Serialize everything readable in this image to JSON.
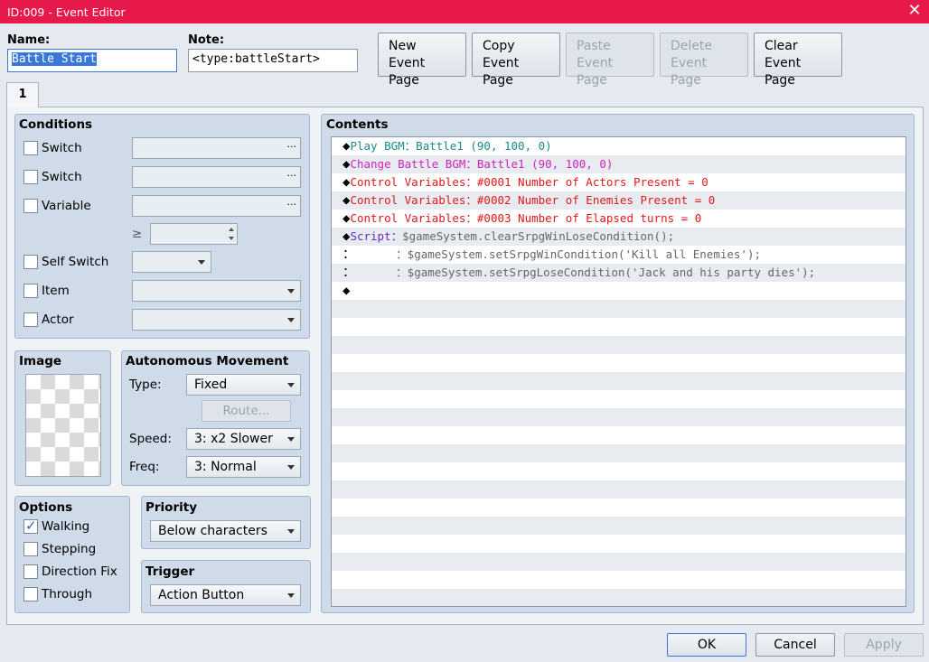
{
  "window": {
    "title": "ID:009 - Event Editor",
    "close_glyph": "✕"
  },
  "header": {
    "name_label": "Name:",
    "name_value": "Battle Start",
    "note_label": "Note:",
    "note_value": "<type:battleStart>"
  },
  "toolbar": {
    "new_l1": "New",
    "new_l2": "Event Page",
    "copy_l1": "Copy",
    "copy_l2": "Event Page",
    "paste_l1": "Paste",
    "paste_l2": "Event Page",
    "delete_l1": "Delete",
    "delete_l2": "Event Page",
    "clear_l1": "Clear",
    "clear_l2": "Event Page"
  },
  "tabs": [
    {
      "label": "1"
    }
  ],
  "conditions": {
    "title": "Conditions",
    "switch1": "Switch",
    "switch2": "Switch",
    "variable": "Variable",
    "gte": "≥",
    "self_switch": "Self Switch",
    "item": "Item",
    "actor": "Actor",
    "dots": "···"
  },
  "image": {
    "title": "Image"
  },
  "movement": {
    "title": "Autonomous Movement",
    "type_label": "Type:",
    "type_value": "Fixed",
    "route_label": "Route...",
    "speed_label": "Speed:",
    "speed_value": "3: x2 Slower",
    "freq_label": "Freq:",
    "freq_value": "3: Normal"
  },
  "options": {
    "title": "Options",
    "walking": "Walking",
    "walking_checked": true,
    "stepping": "Stepping",
    "direction_fix": "Direction Fix",
    "through": "Through"
  },
  "priority": {
    "title": "Priority",
    "value": "Below characters"
  },
  "trigger": {
    "title": "Trigger",
    "value": "Action Button"
  },
  "contents": {
    "title": "Contents",
    "lines": [
      {
        "prefix": "◆",
        "cmd": "Play BGM",
        "sep": "：",
        "arg": "Battle1 (90, 100, 0)",
        "color": "teal"
      },
      {
        "prefix": "◆",
        "cmd": "Change Battle BGM",
        "sep": "：",
        "arg": "Battle1 (90, 100, 0)",
        "color": "mag"
      },
      {
        "prefix": "◆",
        "cmd": "Control Variables",
        "sep": "：",
        "arg": "#0001 Number of Actors Present = 0",
        "color": "red"
      },
      {
        "prefix": "◆",
        "cmd": "Control Variables",
        "sep": "：",
        "arg": "#0002 Number of Enemies Present = 0",
        "color": "red"
      },
      {
        "prefix": "◆",
        "cmd": "Control Variables",
        "sep": "：",
        "arg": "#0003 Number of Elapsed turns = 0",
        "color": "red"
      },
      {
        "prefix": "◆",
        "cmd": "Script",
        "sep": "：",
        "arg": "$gameSystem.clearSrpgWinLoseCondition();",
        "color": "purple"
      },
      {
        "prefix": "：",
        "cmd": "      ",
        "sep": "：",
        "arg": "$gameSystem.setSrpgWinCondition('Kill all Enemies');",
        "color": "gray"
      },
      {
        "prefix": "：",
        "cmd": "      ",
        "sep": "：",
        "arg": "$gameSystem.setSrpgLoseCondition('Jack and his party dies');",
        "color": "gray"
      },
      {
        "prefix": "◆",
        "cmd": "",
        "sep": "",
        "arg": "",
        "color": "gray"
      }
    ]
  },
  "footer": {
    "ok": "OK",
    "cancel": "Cancel",
    "apply": "Apply"
  }
}
